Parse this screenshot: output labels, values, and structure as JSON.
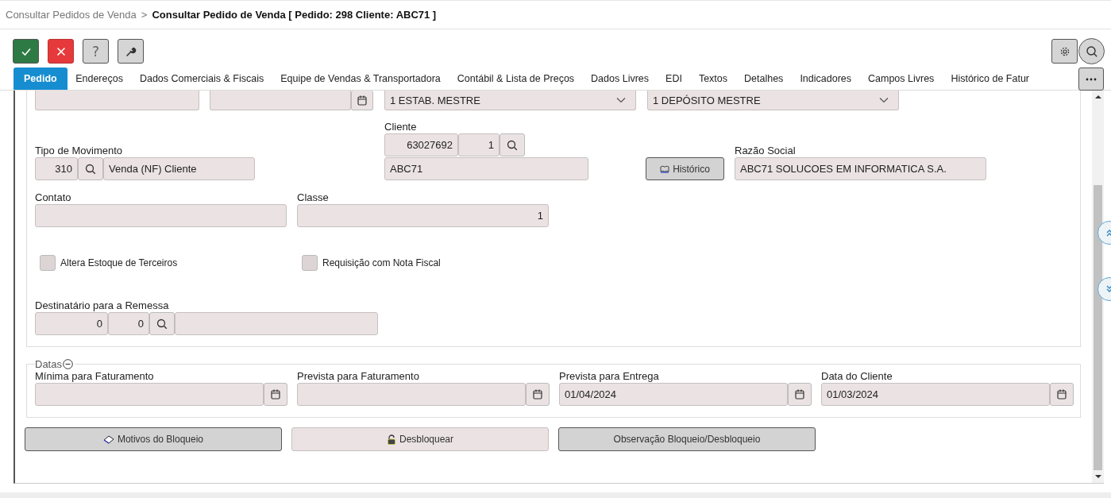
{
  "breadcrumb": {
    "parent": "Consultar Pedidos de Venda",
    "separator": ">",
    "current": "Consultar Pedido de Venda [ Pedido: 298 Cliente: ABC71 ]"
  },
  "toolbar": {
    "help_glyph": "?"
  },
  "tabs": [
    {
      "label": "Pedido",
      "selected": true
    },
    {
      "label": "Endereços",
      "selected": false
    },
    {
      "label": "Dados Comerciais & Fiscais",
      "selected": false
    },
    {
      "label": "Equipe de Vendas & Transportadora",
      "selected": false
    },
    {
      "label": "Contábil & Lista de Preços",
      "selected": false
    },
    {
      "label": "Dados Livres",
      "selected": false
    },
    {
      "label": "EDI",
      "selected": false
    },
    {
      "label": "Textos",
      "selected": false
    },
    {
      "label": "Detalhes",
      "selected": false
    },
    {
      "label": "Indicadores",
      "selected": false
    },
    {
      "label": "Campos Livres",
      "selected": false
    },
    {
      "label": "Histórico de Fatur",
      "selected": false
    }
  ],
  "header_selects": [
    {
      "value": "1 ESTAB. MESTRE"
    },
    {
      "value": "1 DEPÓSITO MESTRE"
    }
  ],
  "tipo_movimento": {
    "label": "Tipo de Movimento",
    "code": "310",
    "description": "Venda (NF) Cliente"
  },
  "cliente": {
    "label": "Cliente",
    "code": "63027692",
    "branch": "1",
    "name": "ABC71"
  },
  "historico_button": "Histórico",
  "razao_social": {
    "label": "Razão Social",
    "value": "ABC71 SOLUCOES EM INFORMATICA S.A."
  },
  "contato": {
    "label": "Contato"
  },
  "classe": {
    "label": "Classe",
    "value": "1"
  },
  "checkboxes": [
    {
      "label": "Altera Estoque de Terceiros",
      "checked": false
    },
    {
      "label": "Requisição com Nota Fiscal",
      "checked": false
    }
  ],
  "destinatario": {
    "label": "Destinatário para a Remessa",
    "code": "0",
    "branch": "0"
  },
  "datas": {
    "legend": "Datas",
    "expanded": true,
    "fields": [
      {
        "label": "Mínima para Faturamento"
      },
      {
        "label": "Prevista para Faturamento"
      },
      {
        "label": "Prevista para Entrega",
        "value": "01/04/2024"
      },
      {
        "label": "Data do Cliente",
        "value": "01/03/2024"
      }
    ]
  },
  "actions": [
    {
      "label": "Motivos do Bloqueio",
      "kind": "reasons",
      "emphasized": true
    },
    {
      "label": "Desbloquear",
      "kind": "unlock",
      "emphasized": false
    },
    {
      "label": "Observação Bloqueio/Desbloqueio",
      "kind": "plain",
      "emphasized": true
    }
  ]
}
